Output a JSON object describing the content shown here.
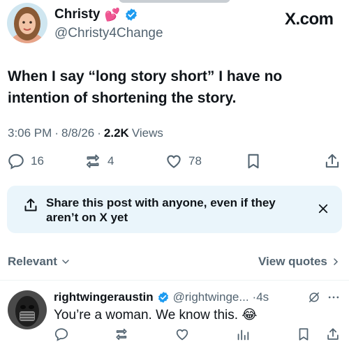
{
  "tweet": {
    "display_name": "Christy",
    "name_emoji": "💕",
    "handle": "@Christy4Change",
    "brand": "X.com",
    "text": "When I say “long story short” I have no intention of shortening the story.",
    "time": "3:06 PM",
    "date": "8/8/26",
    "views_count": "2.2K",
    "views_label": "Views",
    "dot": "·"
  },
  "actions": {
    "replies": "16",
    "reposts": "4",
    "likes": "78"
  },
  "share_banner": {
    "text": "Share this post with anyone, even if they aren’t on X yet"
  },
  "filters": {
    "relevant_label": "Relevant",
    "view_quotes_label": "View quotes"
  },
  "reply": {
    "display_name": "rightwingeraustin",
    "handle": "@rightwinge...",
    "time": "·4s",
    "text": "You’re a woman.  We know this. 😂"
  },
  "colors": {
    "verified_blue": "#1d9bf0",
    "muted": "#536471",
    "banner_bg": "#eaf5fb"
  }
}
